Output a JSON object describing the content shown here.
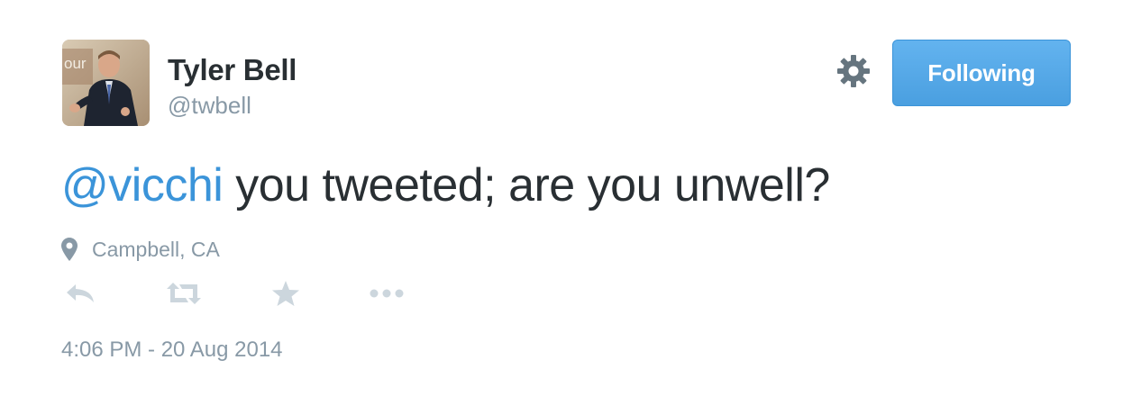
{
  "user": {
    "name": "Tyler Bell",
    "handle": "@twbell",
    "avatar_backdrop_text": "our"
  },
  "follow_button": {
    "label": "Following"
  },
  "tweet": {
    "mention": "@vicchi",
    "text": " you tweeted; are you unwell?",
    "location": "Campbell, CA",
    "timestamp": "4:06 PM - 20 Aug 2014"
  },
  "icons": {
    "settings": "gear-icon",
    "location": "map-pin-icon",
    "reply": "reply-icon",
    "retweet": "retweet-icon",
    "favorite": "star-icon",
    "more": "more-icon"
  },
  "colors": {
    "link": "#3b94d9",
    "text": "#292f33",
    "muted": "#8899a6",
    "button": "#55acee",
    "action_icon": "#ccd6dd"
  }
}
